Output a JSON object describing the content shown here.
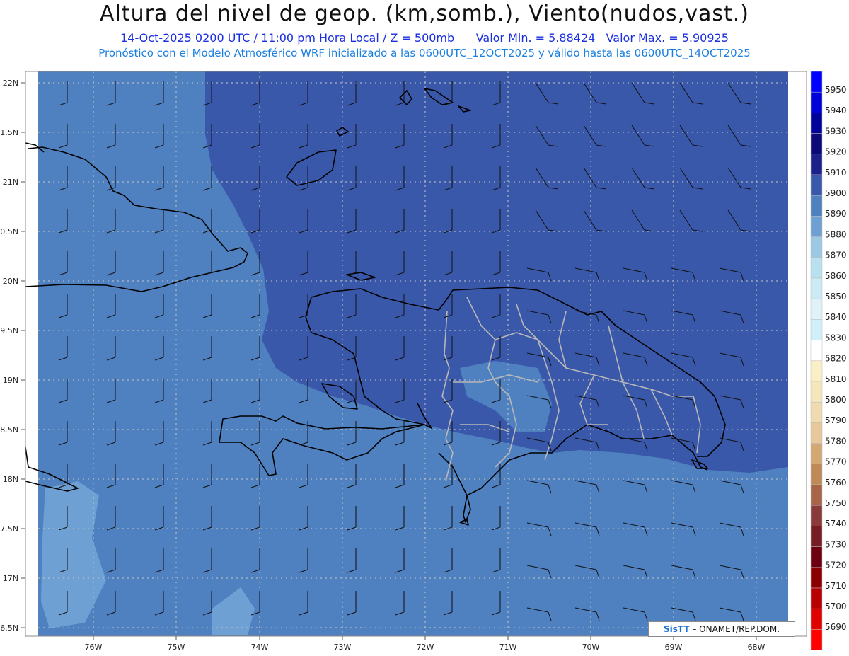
{
  "header": {
    "title": "Altura del nivel de geop. (km,somb.), Viento(nudos,vast.)",
    "line1_date_time": "14-Oct-2025  0200 UTC / 11:00 pm Hora Local / Z = 500mb",
    "line1_min": "Valor Min. = 5.88424",
    "line1_max": "Valor Max. = 5.90925",
    "line2": "Pronóstico con el Modelo Atmosférico WRF inicializado a las 0600UTC_12OCT2025 y válido hasta las  0600UTC_14OCT2025"
  },
  "map": {
    "lat_labels": [
      "22N",
      "1.5N",
      "21N",
      "0.5N",
      "20N",
      "9.5N",
      "19N",
      "8.5N",
      "18N",
      "7.5N",
      "17N",
      "6.5N"
    ],
    "lon_labels": [
      "76W",
      "75W",
      "74W",
      "73W",
      "72W",
      "71W",
      "70W",
      "69W",
      "68W"
    ],
    "colors": {
      "shade_5900": "#3a58aa",
      "shade_5890": "#4f80c0",
      "shade_5880": "#6fa0d4",
      "coast": "#000000",
      "border": "#b8b8b8",
      "grid": "#c8c8c8"
    }
  },
  "colorbar": {
    "levels": [
      "5950",
      "5940",
      "5930",
      "5920",
      "5910",
      "5900",
      "5890",
      "5880",
      "5870",
      "5860",
      "5850",
      "5840",
      "5830",
      "5820",
      "5810",
      "5800",
      "5790",
      "5780",
      "5770",
      "5760",
      "5750",
      "5740",
      "5730",
      "5720",
      "5710",
      "5700",
      "5690"
    ],
    "colors": [
      "#0000ff",
      "#0000d8",
      "#00009a",
      "#0c0878",
      "#1c208a",
      "#3a58aa",
      "#4f80c0",
      "#6fa0d4",
      "#9cc8e4",
      "#b9e0ee",
      "#cdeaf4",
      "#dff2f8",
      "#cff0f8",
      "#ffffff",
      "#faf0c8",
      "#f6e6bc",
      "#f0dab0",
      "#e8c89a",
      "#d4a872",
      "#c08a58",
      "#a86446",
      "#8a3a3a",
      "#781c24",
      "#6a0010",
      "#8a0000",
      "#b80000",
      "#e00000",
      "#ff0000"
    ]
  },
  "credit": {
    "logo": "SisTT",
    "text": "– ONAMET/REP.DOM."
  }
}
